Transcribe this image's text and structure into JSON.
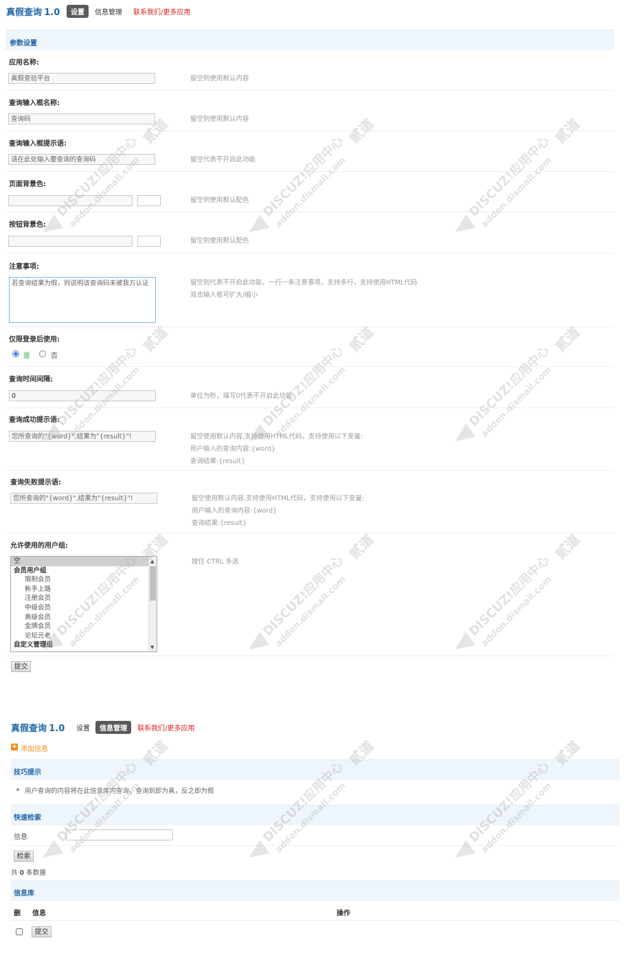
{
  "header1": {
    "app_name": "真假查询",
    "version": "1.0",
    "tab_settings": "设置",
    "tab_info": "信息管理",
    "contact": "联系我们/更多应用"
  },
  "params": {
    "section_title": "参数设置",
    "app_name_label": "应用名称:",
    "app_name_value": "真假查验平台",
    "app_name_hint": "留空则使用默认内容",
    "input_name_label": "查询输入框名称:",
    "input_name_value": "查询码",
    "input_name_hint": "留空则使用默认内容",
    "input_tip_label": "查询输入框提示语:",
    "input_tip_value": "请在此处输入要查询的查询码",
    "input_tip_hint": "留空代表不开启此功能",
    "bg_color_label": "页面背景色:",
    "bg_color_hint": "留空则使用默认配色",
    "btn_color_label": "按钮背景色:",
    "btn_color_hint": "留空则使用默认配色",
    "notice_label": "注意事项:",
    "notice_value": "若查询结果为假，则说明该查询码未被我方认证",
    "notice_hint1": "留空则代表不开启此功能，一行一条注意事项，支持多行，支持使用HTML代码",
    "notice_hint2": "双击输入框可扩大/缩小",
    "login_label": "仅限登录后使用:",
    "login_yes": "是",
    "login_no": "否",
    "interval_label": "查询时间间隔:",
    "interval_value": "0",
    "interval_hint": "单位为秒，填写0代表不开启此功能",
    "success_label": "查询成功提示语:",
    "success_value": "您所查询的\"{word}\",结果为\"{result}\"!",
    "success_hint1": "留空使用默认内容,支持使用HTML代码，支持使用以下变量:",
    "success_hint2": "用户输入的查询内容:{word}",
    "success_hint3": "查询结果:{result}",
    "fail_label": "查询失败提示语:",
    "fail_value": "您所查询的\"{word}\",结果为\"{result}\"!",
    "fail_hint1": "留空使用默认内容,支持使用HTML代码，支持使用以下变量:",
    "fail_hint2": "用户输入的查询内容:{word}",
    "fail_hint3": "查询结果:{result}",
    "groups_label": "允许使用的用户组:",
    "groups_hint": "按住 CTRL 多选",
    "groups_options": [
      "空",
      "会员用户组",
      "限制会员",
      "新手上路",
      "注册会员",
      "中级会员",
      "高级会员",
      "金牌会员",
      "论坛元老",
      "自定义管理组"
    ],
    "submit": "提交"
  },
  "header2": {
    "app_name": "真假查询",
    "version": "1.0",
    "tab_settings": "设置",
    "tab_info": "信息管理",
    "contact": "联系我们/更多应用"
  },
  "info": {
    "add_label": "添加信息",
    "tips_title": "技巧提示",
    "tip_text": "用户查询的内容将在此信息库内查询，查询到即为真，反之即为假",
    "search_title": "快速检索",
    "search_label": "信息",
    "search_button": "检索",
    "count_prefix": "共",
    "count_value": "0",
    "count_suffix": "条数据",
    "library_title": "信息库",
    "col_delete": "删",
    "col_info": "信息",
    "col_action": "操作",
    "submit": "提交"
  },
  "watermark": {
    "brand": "DISCUZ!应用中心",
    "url": "addon.dismall.com",
    "cn": "贰道"
  },
  "colors": {
    "accent": "#2366a8",
    "band": "#eef5fb",
    "red": "#e21d1d",
    "add_icon": "#f08c1a"
  }
}
